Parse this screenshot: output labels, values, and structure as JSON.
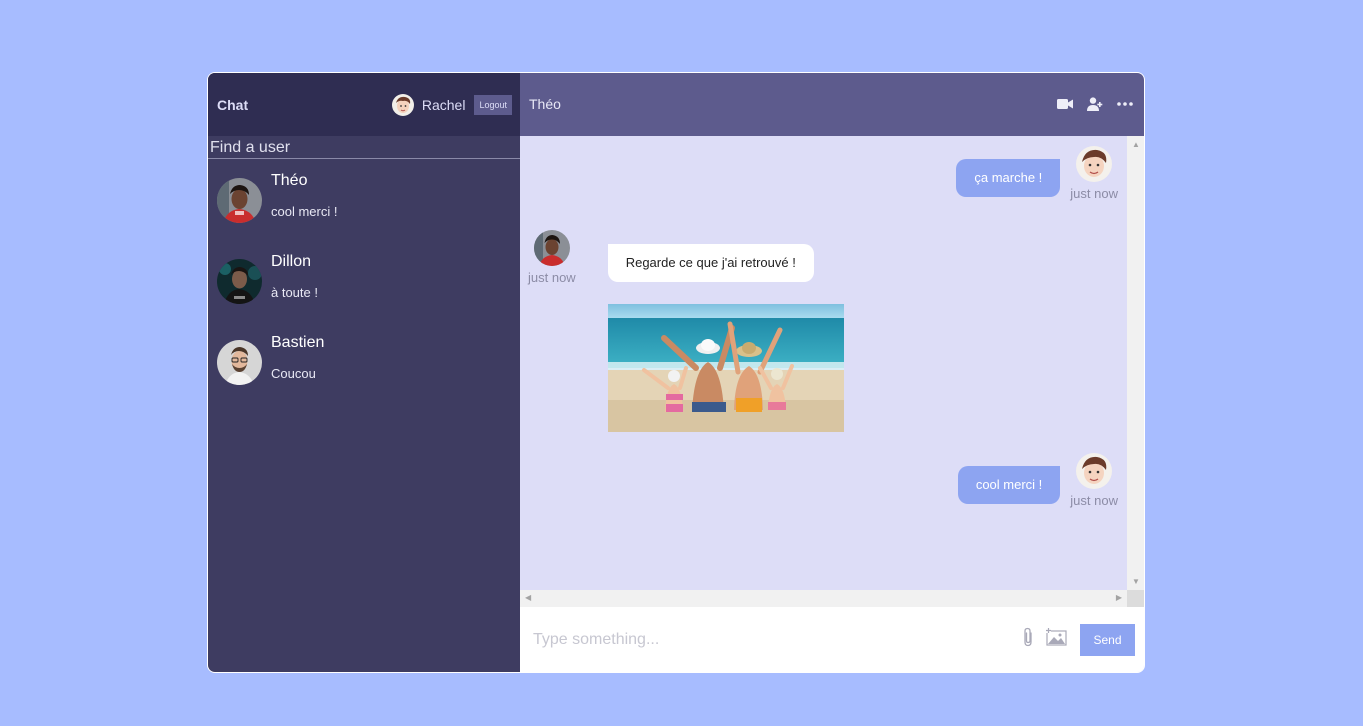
{
  "sidebar": {
    "brand": "Chat",
    "current_user": {
      "name": "Rachel",
      "avatar": "boy-cartoon-avatar"
    },
    "logout_label": "Logout",
    "search": {
      "placeholder": "Find a user",
      "value": ""
    },
    "chats": [
      {
        "name": "Théo",
        "last_message": "cool merci !",
        "avatar": "young-man-red-shirt"
      },
      {
        "name": "Dillon",
        "last_message": "à toute !",
        "avatar": "man-dark-teal-background"
      },
      {
        "name": "Bastien",
        "last_message": "Coucou",
        "avatar": "man-glasses-beard"
      }
    ]
  },
  "chat": {
    "title": "Théo",
    "header_icons": [
      "video-camera-icon",
      "add-user-icon",
      "more-icon"
    ],
    "messages": [
      {
        "owner": true,
        "text": "ça marche !",
        "time": "just now"
      },
      {
        "owner": false,
        "text": "Regarde ce que j'ai retrouvé !",
        "time": "just now",
        "image": "family-on-beach-photo"
      },
      {
        "owner": true,
        "text": "cool merci !",
        "time": "just now"
      }
    ],
    "input": {
      "placeholder": "Type something...",
      "value": ""
    },
    "send_label": "Send",
    "input_icons": [
      "paperclip-icon",
      "add-image-icon"
    ]
  },
  "colors": {
    "background": "#a7bcff",
    "sidebar": "#3e3c61",
    "sidebar_top": "#2f2d52",
    "chat_header": "#5d5b8d",
    "chat_bg": "#ddddf7",
    "owner_bubble": "#8da4f1",
    "accent": "#8da4f1"
  }
}
